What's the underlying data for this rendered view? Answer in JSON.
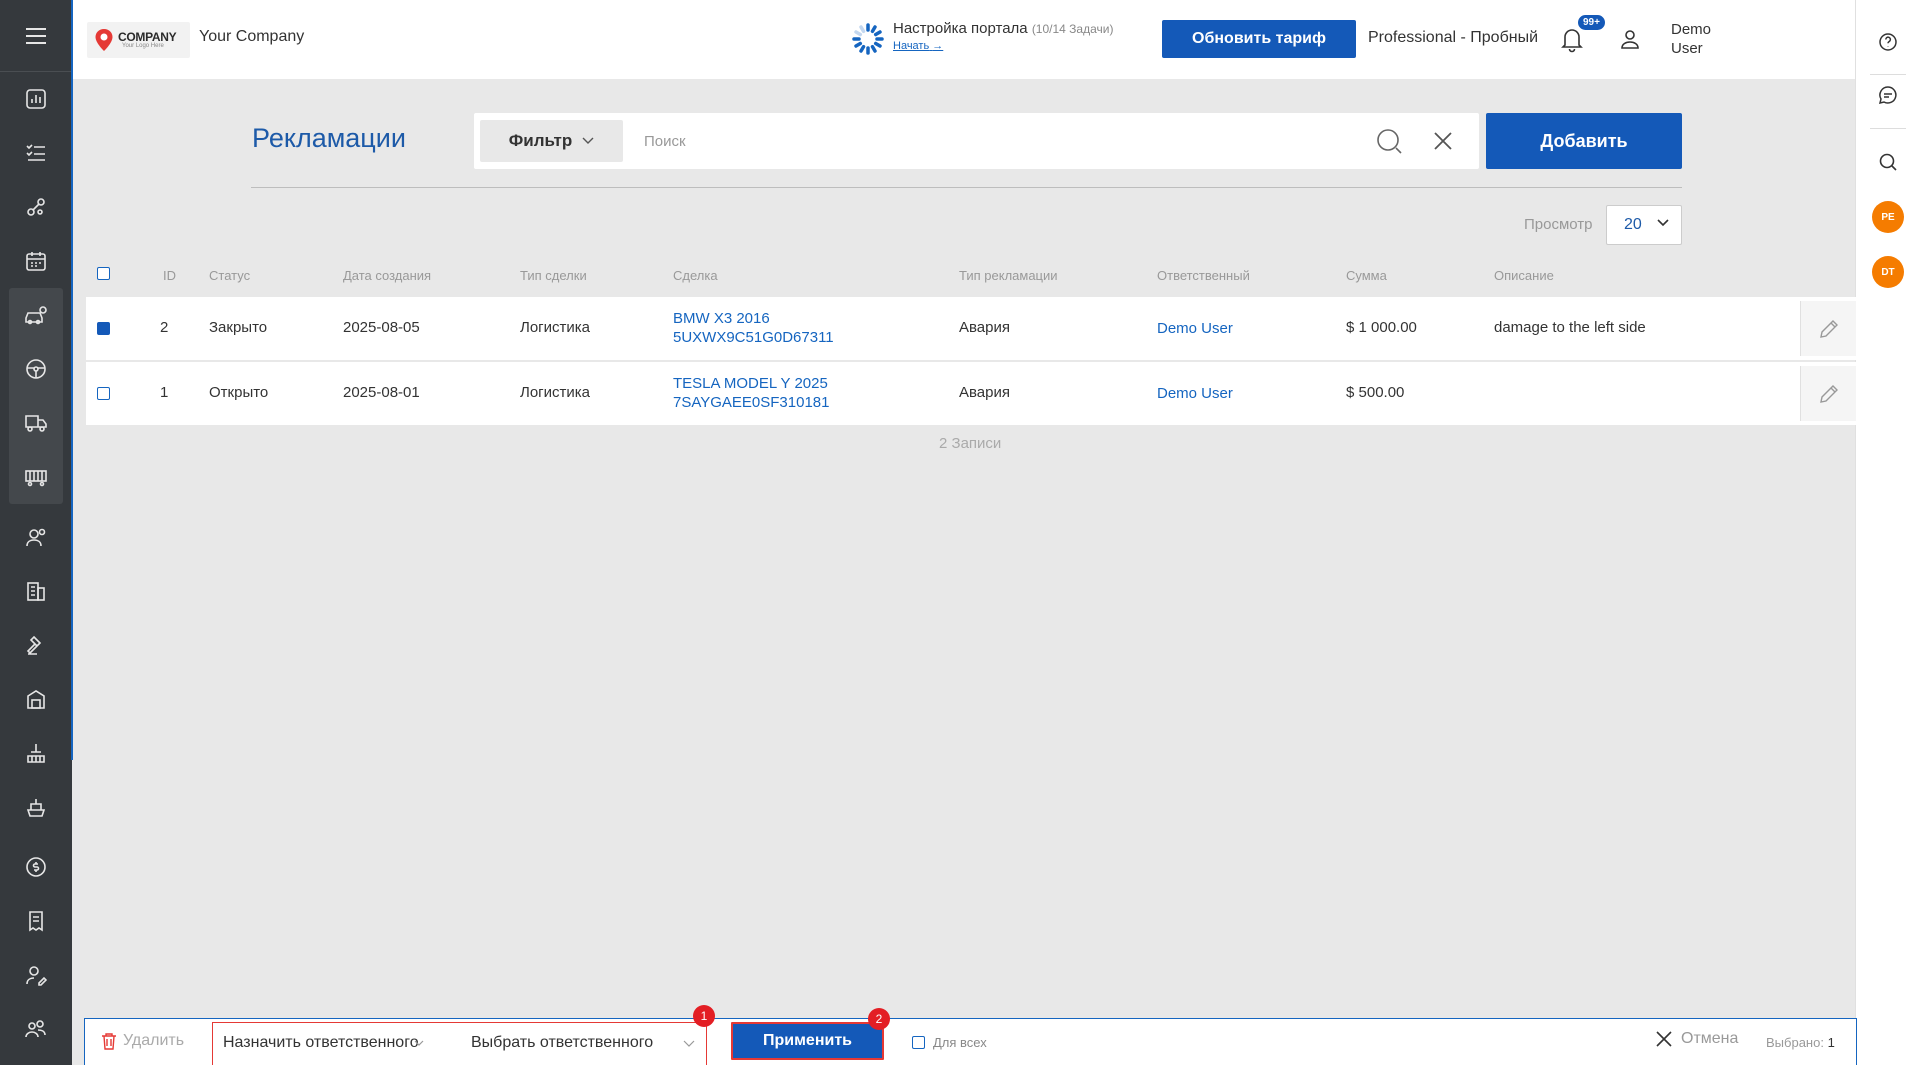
{
  "header": {
    "company_name": "Your Company",
    "logo": {
      "name": "COMPANY",
      "tagline": "Your Logo Here"
    },
    "setup_title": "Настройка портала",
    "setup_progress": "(10/14 Задачи)",
    "setup_link": "Начать",
    "upgrade_button": "Обновить тариф",
    "plan": "Professional - Пробный",
    "notifications_badge": "99+",
    "user_first": "Demo",
    "user_last": "User"
  },
  "sidebar": {
    "icons": [
      "menu-icon",
      "dashboard-icon",
      "tasks-list-icon",
      "workflow-icon",
      "calendar-icon",
      "car-dealer-icon",
      "steering-wheel-icon",
      "delivery-truck-icon",
      "rail-car-icon",
      "contacts-icon",
      "buildings-icon",
      "auction-hammer-icon",
      "warehouse-icon",
      "port-crane-icon",
      "ship-icon",
      "finance-exchange-icon",
      "invoice-icon",
      "user-edit-icon",
      "team-icon",
      "settings-icon"
    ]
  },
  "right_sidebar": {
    "avatars": [
      "PE",
      "DT"
    ]
  },
  "page": {
    "title": "Рекламации",
    "filter_label": "Фильтр",
    "search_placeholder": "Поиск",
    "add_button": "Добавить",
    "view_label": "Просмотр",
    "view_value": "20",
    "records_text": "2 Записи"
  },
  "table": {
    "columns": [
      "ID",
      "Статус",
      "Дата создания",
      "Тип сделки",
      "Сделка",
      "Тип рекламации",
      "Ответственный",
      "Сумма",
      "Описание"
    ],
    "rows": [
      {
        "checked": true,
        "id": "2",
        "status": "Закрыто",
        "date": "2025-08-05",
        "deal_type": "Логистика",
        "deal_line1": "BMW X3 2016",
        "deal_line2": "5UXWX9C51G0D67311",
        "claim_type": "Авария",
        "responsible": "Demo User",
        "amount": "$ 1 000.00",
        "description": "damage to the left side"
      },
      {
        "checked": false,
        "id": "1",
        "status": "Открыто",
        "date": "2025-08-01",
        "deal_type": "Логистика",
        "deal_line1": "TESLA MODEL Y 2025",
        "deal_line2": "7SAYGAEE0SF310181",
        "claim_type": "Авария",
        "responsible": "Demo User",
        "amount": "$ 500.00",
        "description": ""
      }
    ]
  },
  "action_bar": {
    "delete_label": "Удалить",
    "action_select": "Назначить ответственного",
    "responsible_select": "Выбрать ответственного",
    "apply_button": "Применить",
    "for_all_label": "Для всех",
    "cancel_label": "Отмена",
    "selected_label": "Выбрано:",
    "selected_count": "1",
    "marker_1": "1",
    "marker_2": "2"
  },
  "colors": {
    "primary": "#1459b8",
    "sidebar": "#35393d",
    "link": "#1565c0",
    "marker": "#e31e24",
    "avatar": "#f57c00"
  }
}
